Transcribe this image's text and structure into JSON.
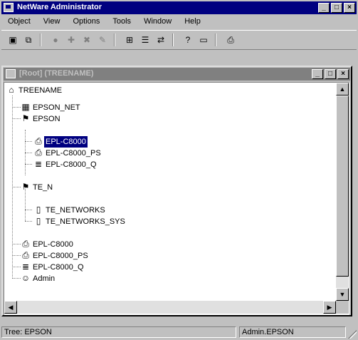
{
  "app": {
    "title": "NetWare Administrator",
    "controls": {
      "minimize": "_",
      "maximize": "□",
      "close": "×"
    }
  },
  "menu": [
    "Object",
    "View",
    "Options",
    "Tools",
    "Window",
    "Help"
  ],
  "toolbar": {
    "icons": [
      "object-icon",
      "copy-icon",
      "find-icon",
      "add-icon",
      "delete-icon",
      "rename-icon",
      "search-icon",
      "details-icon",
      "move-icon",
      "help-icon",
      "window-icon",
      "printer-icon"
    ]
  },
  "child": {
    "title": "[Root] (TREENAME)",
    "controls": {
      "minimize": "_",
      "maximize": "□",
      "close": "×"
    }
  },
  "tree": {
    "root": "TREENAME",
    "items": [
      {
        "label": "EPSON_NET"
      },
      {
        "label": "EPSON"
      },
      {
        "label": "EPL-C8000",
        "selected": true
      },
      {
        "label": "EPL-C8000_PS"
      },
      {
        "label": "EPL-C8000_Q"
      },
      {
        "label": "TE_N"
      },
      {
        "label": "TE_NETWORKS"
      },
      {
        "label": "TE_NETWORKS_SYS"
      },
      {
        "label": "EPL-C8000"
      },
      {
        "label": "EPL-C8000_PS"
      },
      {
        "label": "EPL-C8000_Q"
      },
      {
        "label": "Admin"
      }
    ]
  },
  "status": {
    "left": "Tree: EPSON",
    "right": "Admin.EPSON"
  }
}
